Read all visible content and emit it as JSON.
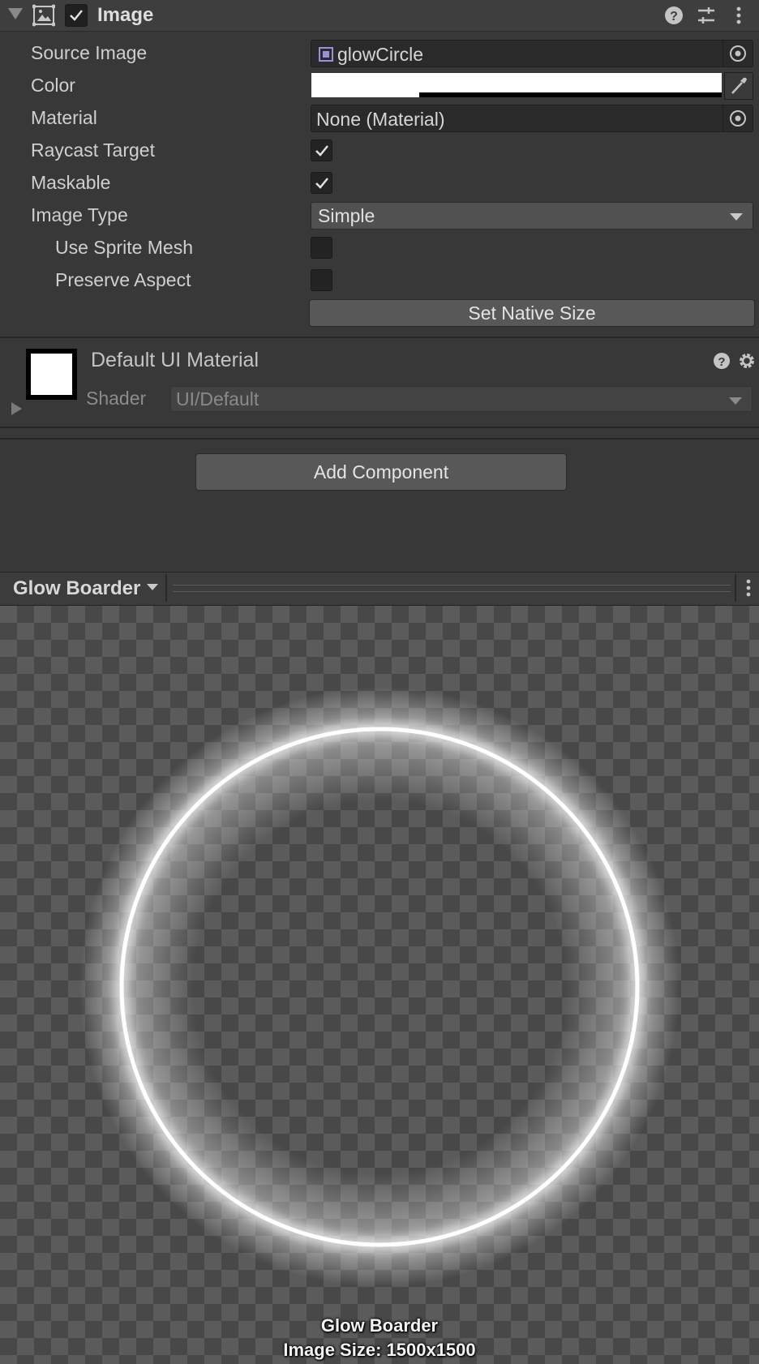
{
  "component": {
    "title": "Image",
    "enabled": true,
    "icons": [
      "image-component-icon",
      "help-icon",
      "preset-sliders-icon",
      "kebab-menu-icon"
    ]
  },
  "fields": {
    "source_image": {
      "label": "Source Image",
      "value": "glowCircle"
    },
    "color": {
      "label": "Color",
      "value": "#FFFFFF"
    },
    "material": {
      "label": "Material",
      "value": "None (Material)"
    },
    "raycast_target": {
      "label": "Raycast Target",
      "checked": true
    },
    "maskable": {
      "label": "Maskable",
      "checked": true
    },
    "image_type": {
      "label": "Image Type",
      "value": "Simple"
    },
    "use_sprite_mesh": {
      "label": "Use Sprite Mesh",
      "checked": false
    },
    "preserve_aspect": {
      "label": "Preserve Aspect",
      "checked": false
    }
  },
  "buttons": {
    "set_native_size": "Set Native Size",
    "add_component": "Add Component"
  },
  "material_section": {
    "title": "Default UI Material",
    "shader_label": "Shader",
    "shader_value": "UI/Default"
  },
  "preview": {
    "title": "Glow Boarder",
    "caption_name": "Glow Boarder",
    "caption_size": "Image Size: 1500x1500"
  }
}
